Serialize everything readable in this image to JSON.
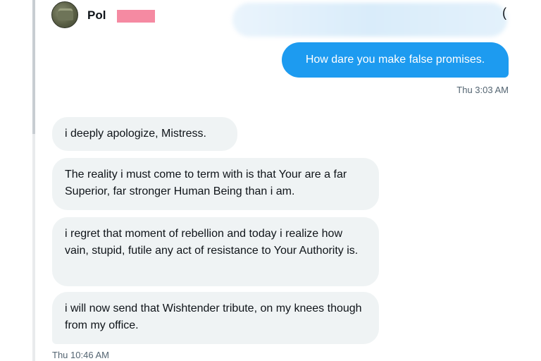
{
  "header": {
    "contact_name": "Pol",
    "icon": "circle-icon",
    "icon_glyph": "("
  },
  "messages": {
    "sent": [
      {
        "text": "How dare you make false promises.",
        "timestamp": "Thu 3:03 AM"
      }
    ],
    "received": [
      {
        "text": "i deeply apologize, Mistress."
      },
      {
        "text": "The reality i must come to term with is that Your are a far Superior, far stronger Human Being than i am."
      },
      {
        "text": "i regret that moment of rebellion and today i realize how vain, stupid, futile any act of resistance to Your Authority is."
      },
      {
        "text": "i will now send that Wishtender tribute, on my knees though from my office."
      }
    ],
    "received_timestamp": "Thu 10:46 AM"
  },
  "colors": {
    "sent_bubble": "#1d9bf0",
    "received_bubble": "#eff3f4",
    "redaction": "#f58aa2"
  }
}
